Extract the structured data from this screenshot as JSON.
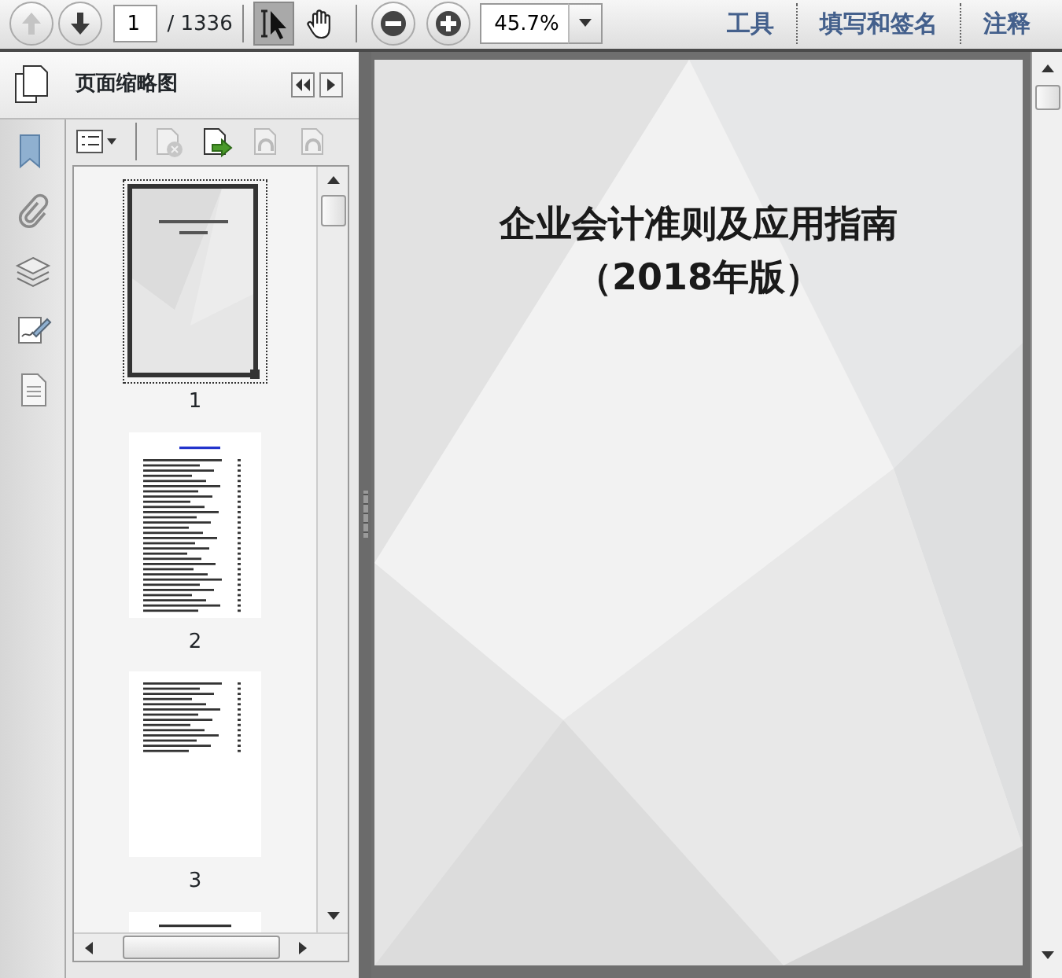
{
  "toolbar": {
    "nav_buttons": [
      {
        "kind": "prev",
        "disabled": true
      },
      {
        "kind": "next",
        "disabled": false
      }
    ],
    "page_number": "1",
    "page_total": "/ 1336",
    "tools": [
      {
        "kind": "select",
        "selected": true
      },
      {
        "kind": "hand",
        "selected": false
      }
    ],
    "zoom": "45.7%",
    "links": [
      "工具",
      "填写和签名",
      "注释"
    ]
  },
  "side_panel": {
    "title": "页面缩略图",
    "actions": [
      {
        "kind": "options",
        "disabled": false
      },
      {
        "kind": "delete",
        "disabled": true
      },
      {
        "kind": "insert",
        "disabled": false
      },
      {
        "kind": "undo",
        "disabled": true
      },
      {
        "kind": "redo",
        "disabled": true
      }
    ],
    "thumbnails": [
      {
        "kind": "cover",
        "label": "1",
        "selected": true
      },
      {
        "kind": "contents",
        "label": "2",
        "selected": false
      },
      {
        "kind": "contents-short",
        "label": "3",
        "selected": false
      },
      {
        "kind": "partial",
        "selected": false
      }
    ]
  },
  "document": {
    "title_lines": [
      "企业会计准则及应用指南",
      "（2018年版）"
    ]
  }
}
